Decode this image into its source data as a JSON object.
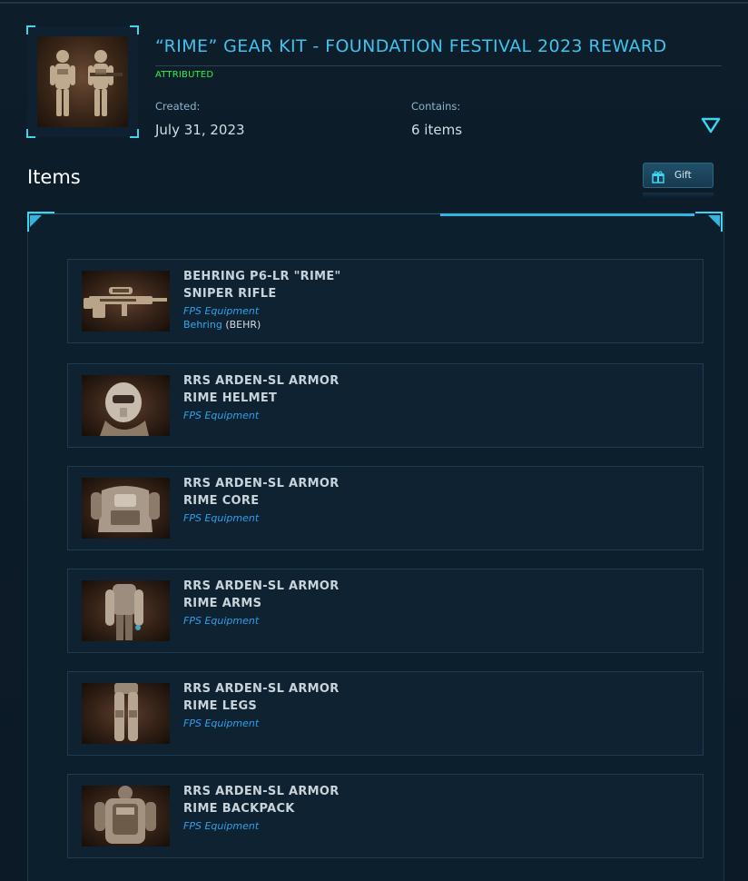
{
  "kit": {
    "title": "“RIME” GEAR KIT - FOUNDATION FESTIVAL 2023 REWARD",
    "status": "ATTRIBUTED",
    "created_label": "Created:",
    "created_value": "July 31, 2023",
    "contains_label": "Contains:",
    "contains_value": "6 items",
    "thumbnail_icon": "armored-soldiers-image"
  },
  "items_section": {
    "heading": "Items",
    "gift_label": "Gift",
    "gift_icon": "gift-box-icon"
  },
  "items": [
    {
      "name_line1": "BEHRING P6-LR \"RIME\"",
      "name_line2": "SNIPER RIFLE",
      "type": "FPS Equipment",
      "manufacturer": "Behring",
      "manufacturer_code": "(BEHR)",
      "image": "sniper-rifle-image"
    },
    {
      "name_line1": "RRS ARDEN-SL ARMOR",
      "name_line2": "RIME HELMET",
      "type": "FPS Equipment",
      "image": "helmet-image"
    },
    {
      "name_line1": "RRS ARDEN-SL ARMOR",
      "name_line2": "RIME CORE",
      "type": "FPS Equipment",
      "image": "core-armor-image"
    },
    {
      "name_line1": "RRS ARDEN-SL ARMOR",
      "name_line2": "RIME ARMS",
      "type": "FPS Equipment",
      "image": "arms-armor-image"
    },
    {
      "name_line1": "RRS ARDEN-SL ARMOR",
      "name_line2": "RIME LEGS",
      "type": "FPS Equipment",
      "image": "legs-armor-image"
    },
    {
      "name_line1": "RRS ARDEN-SL ARMOR",
      "name_line2": "RIME BACKPACK",
      "type": "FPS Equipment",
      "image": "backpack-image"
    }
  ],
  "colors": {
    "accent": "#3fc3ee",
    "status_green": "#2ef04a",
    "link_blue": "#2f9fea",
    "background": "#0b1a26"
  }
}
